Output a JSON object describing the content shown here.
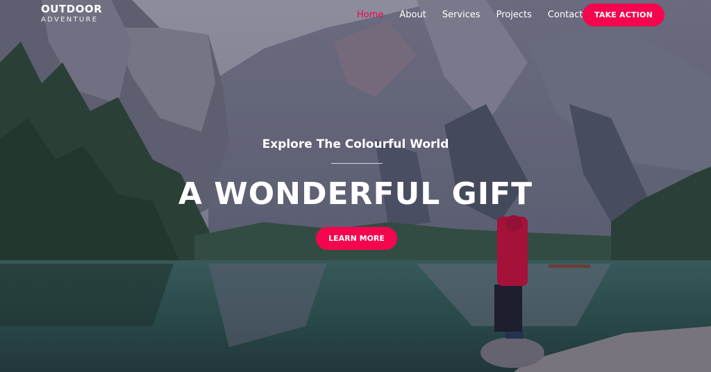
{
  "brand": {
    "name": "OUTDOOR",
    "tagline": "ADVENTURE"
  },
  "nav": {
    "items": [
      {
        "label": "Home",
        "active": true
      },
      {
        "label": "About",
        "active": false
      },
      {
        "label": "Services",
        "active": false
      },
      {
        "label": "Projects",
        "active": false
      },
      {
        "label": "Contact",
        "active": false
      }
    ],
    "cta_label": "TAKE ACTION"
  },
  "hero": {
    "subtitle": "Explore The Colourful World",
    "headline": "A WONDERFUL GIFT",
    "cta_label": "LEARN MORE",
    "background_icon": "mountain-lake-photo"
  },
  "colors": {
    "accent": "#f4064e",
    "text": "#ffffff"
  }
}
